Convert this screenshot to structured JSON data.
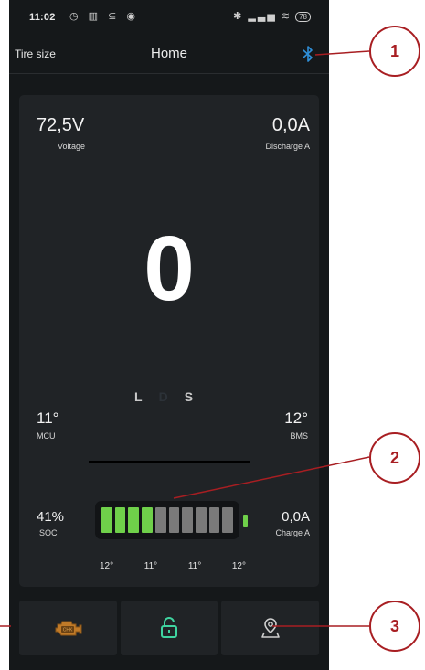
{
  "status_bar": {
    "time": "11:02",
    "battery": "78"
  },
  "nav": {
    "tire_size_label": "Tire size",
    "title": "Home"
  },
  "dashboard": {
    "voltage_value": "72,5V",
    "voltage_label": "Voltage",
    "discharge_value": "0,0A",
    "discharge_label": "Discharge A",
    "speed": "0",
    "gears": [
      "L",
      "D",
      "S"
    ],
    "active_gear": "D",
    "mcu_temp": "11°",
    "mcu_label": "MCU",
    "bms_temp": "12°",
    "bms_label": "BMS",
    "soc_value": "41%",
    "soc_label": "SOC",
    "charge_value": "0,0A",
    "charge_label": "Charge A",
    "battery_cells_total": 10,
    "battery_cells_lit": 4,
    "cell_temps": [
      "12°",
      "11°",
      "11°",
      "12°"
    ]
  },
  "bottom_buttons": [
    {
      "name": "engine-check-icon"
    },
    {
      "name": "unlock-icon"
    },
    {
      "name": "map-pin-icon"
    }
  ],
  "callouts": [
    "1",
    "2",
    "3"
  ],
  "colors": {
    "background": "#15181a",
    "card": "#202326",
    "accent_green": "#6fd04a",
    "bluetooth_blue": "#2f8fd8",
    "callout_red": "#a81e22"
  }
}
